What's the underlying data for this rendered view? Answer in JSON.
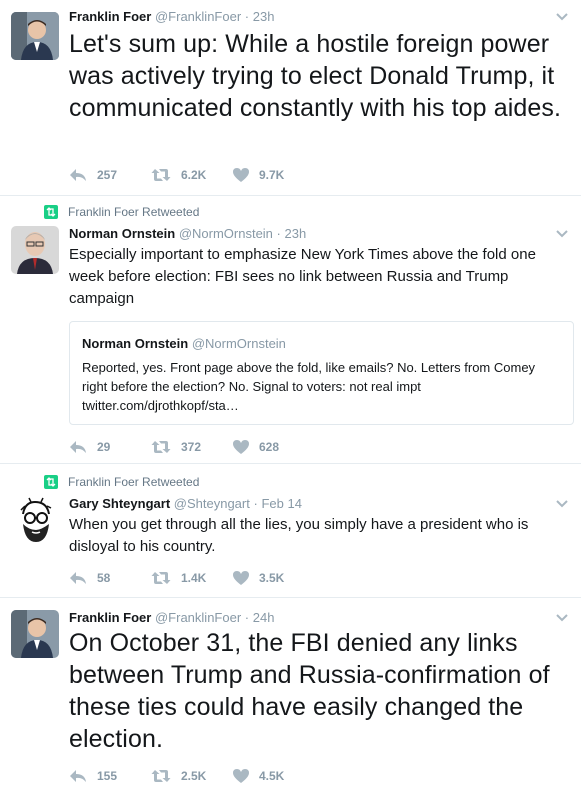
{
  "tweets": [
    {
      "retweeted_by": "",
      "name": "Franklin Foer",
      "handle": "@FranklinFoer",
      "time": "23h",
      "text": "Let's sum up: While a hostile foreign power was actively trying to elect Donald Trump, it communicated constantly with his top aides.",
      "replies": "257",
      "retweets": "6.2K",
      "likes": "9.7K"
    },
    {
      "retweeted_by": "Franklin Foer Retweeted",
      "name": "Norman Ornstein",
      "handle": "@NormOrnstein",
      "time": "23h",
      "text": "Especially important to emphasize New York Times above the fold one week before election: FBI sees no link between Russia and Trump campaign",
      "quote": {
        "name": "Norman Ornstein",
        "handle": "@NormOrnstein",
        "text": "Reported, yes. Front page above the fold, like emails? No. Letters from Comey right before the election? No. Signal to voters: not real impt twitter.com/djrothkopf/sta…"
      },
      "replies": "29",
      "retweets": "372",
      "likes": "628"
    },
    {
      "retweeted_by": "Franklin Foer Retweeted",
      "name": "Gary Shteyngart",
      "handle": "@Shteyngart",
      "time": "Feb 14",
      "text": "When you get through all the lies, you simply have a president who is disloyal to his country.",
      "replies": "58",
      "retweets": "1.4K",
      "likes": "3.5K"
    },
    {
      "retweeted_by": "",
      "name": "Franklin Foer",
      "handle": "@FranklinFoer",
      "time": "24h",
      "text": "On October 31, the FBI denied any links between Trump and Russia-confirmation of these ties could have easily changed the election.",
      "replies": "155",
      "retweets": "2.5K",
      "likes": "4.5K"
    }
  ],
  "separator": "·",
  "colors": {
    "icon_gray": "#aab8c2",
    "count_gray": "#8899a6",
    "retweet_green": "#19cf86"
  },
  "icons": {
    "reply": "reply-icon",
    "retweet": "retweet-icon",
    "like": "heart-icon",
    "retweeted": "retweeted-icon",
    "menu": "chevron-down-icon"
  }
}
